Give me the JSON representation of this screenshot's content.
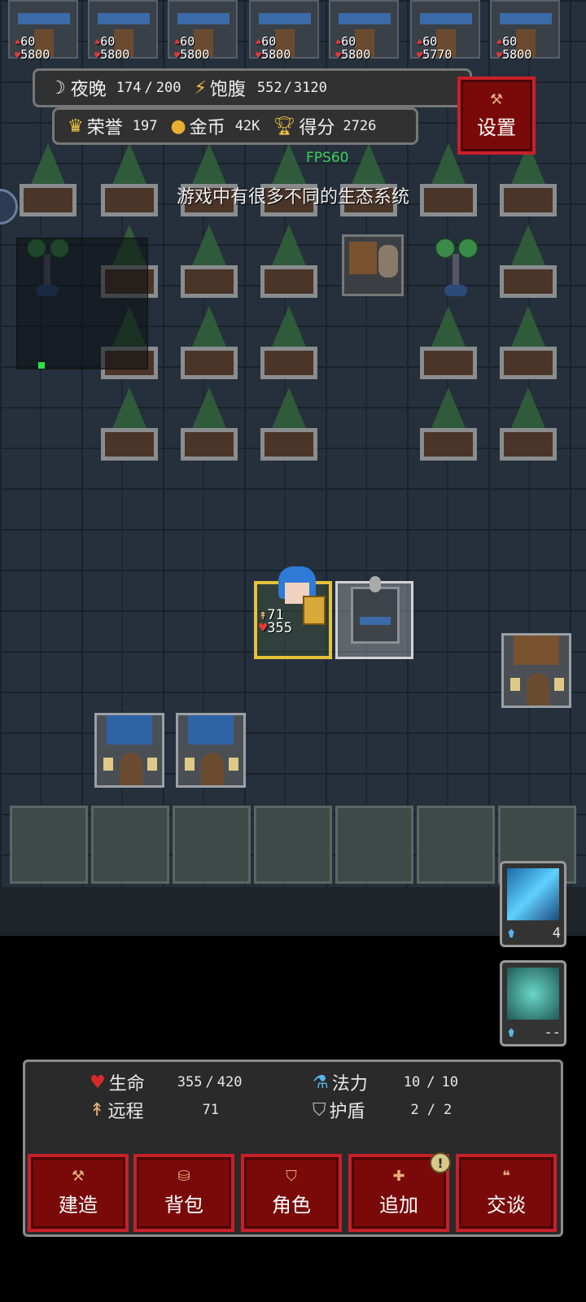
{
  "top_units": [
    {
      "atk": "60",
      "hp": "5800"
    },
    {
      "atk": "60",
      "hp": "5800"
    },
    {
      "atk": "60",
      "hp": "5800"
    },
    {
      "atk": "60",
      "hp": "5800"
    },
    {
      "atk": "60",
      "hp": "5800"
    },
    {
      "atk": "60",
      "hp": "5770"
    },
    {
      "atk": "60",
      "hp": "5800"
    }
  ],
  "hud": {
    "night_label": "夜晚",
    "night_value": "174",
    "night_max": "200",
    "satiety_label": "饱腹",
    "satiety_value": "552",
    "satiety_max": "3120",
    "honor_label": "荣誉",
    "honor_value": "197",
    "gold_label": "金币",
    "gold_value": "42K",
    "score_label": "得分",
    "score_value": "2726",
    "settings_label": "设置",
    "fps": "FPS60",
    "tip": "游戏中有很多不同的生态系统"
  },
  "hero": {
    "atk": "71",
    "hp": "355"
  },
  "skills": [
    {
      "name": "lightning",
      "count": "4"
    },
    {
      "name": "shield",
      "count": "--"
    }
  ],
  "stats": {
    "hp_label": "生命",
    "hp_value": "355",
    "hp_max": "420",
    "mp_label": "法力",
    "mp_value": "10",
    "mp_max": "10",
    "range_label": "远程",
    "range_value": "71",
    "shield_label": "护盾",
    "shield_value": "2",
    "shield_max": "2"
  },
  "actions": [
    {
      "label": "建造",
      "icon": "hammer-icon"
    },
    {
      "label": "背包",
      "icon": "bag-icon"
    },
    {
      "label": "角色",
      "icon": "shield-badge-icon"
    },
    {
      "label": "追加",
      "icon": "plus-icon"
    },
    {
      "label": "交谈",
      "icon": "speech-icon"
    }
  ],
  "colors": {
    "accent_red": "#c8202a",
    "fps_green": "#3ccf5a",
    "hero_border": "#e4c23a"
  }
}
